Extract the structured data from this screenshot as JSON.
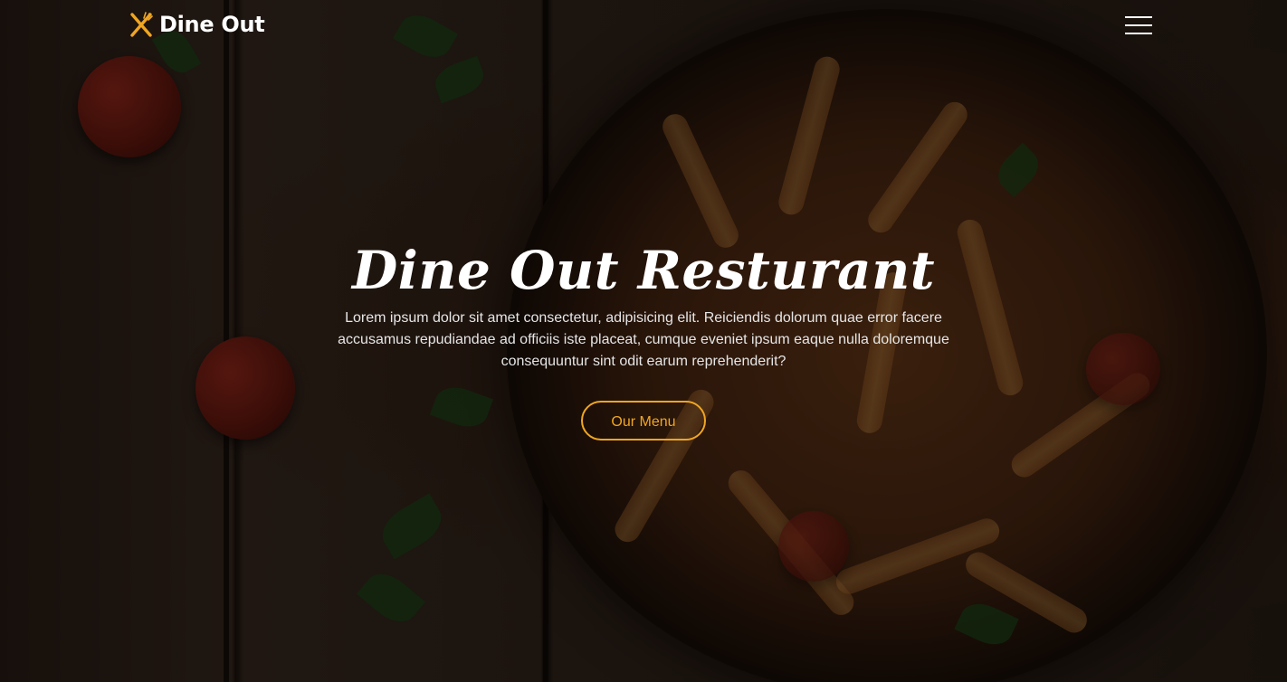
{
  "navbar": {
    "brand_name": "Dine Out",
    "brand_icon": "fork-knife-icon",
    "menu_icon": "hamburger-menu-icon"
  },
  "hero": {
    "title": "Dine Out Resturant",
    "description": "Lorem ipsum dolor sit amet consectetur, adipisicing elit. Reiciendis dolorum quae error facere accusamus repudiandae ad officiis iste placeat, cumque eveniet ipsum eaque nulla doloremque consequuntur sint odit earum reprehenderit?",
    "cta_label": "Our Menu"
  },
  "colors": {
    "accent": "#f0a623",
    "text": "#ffffff",
    "overlay": "rgba(0,0,0,0.45)"
  }
}
